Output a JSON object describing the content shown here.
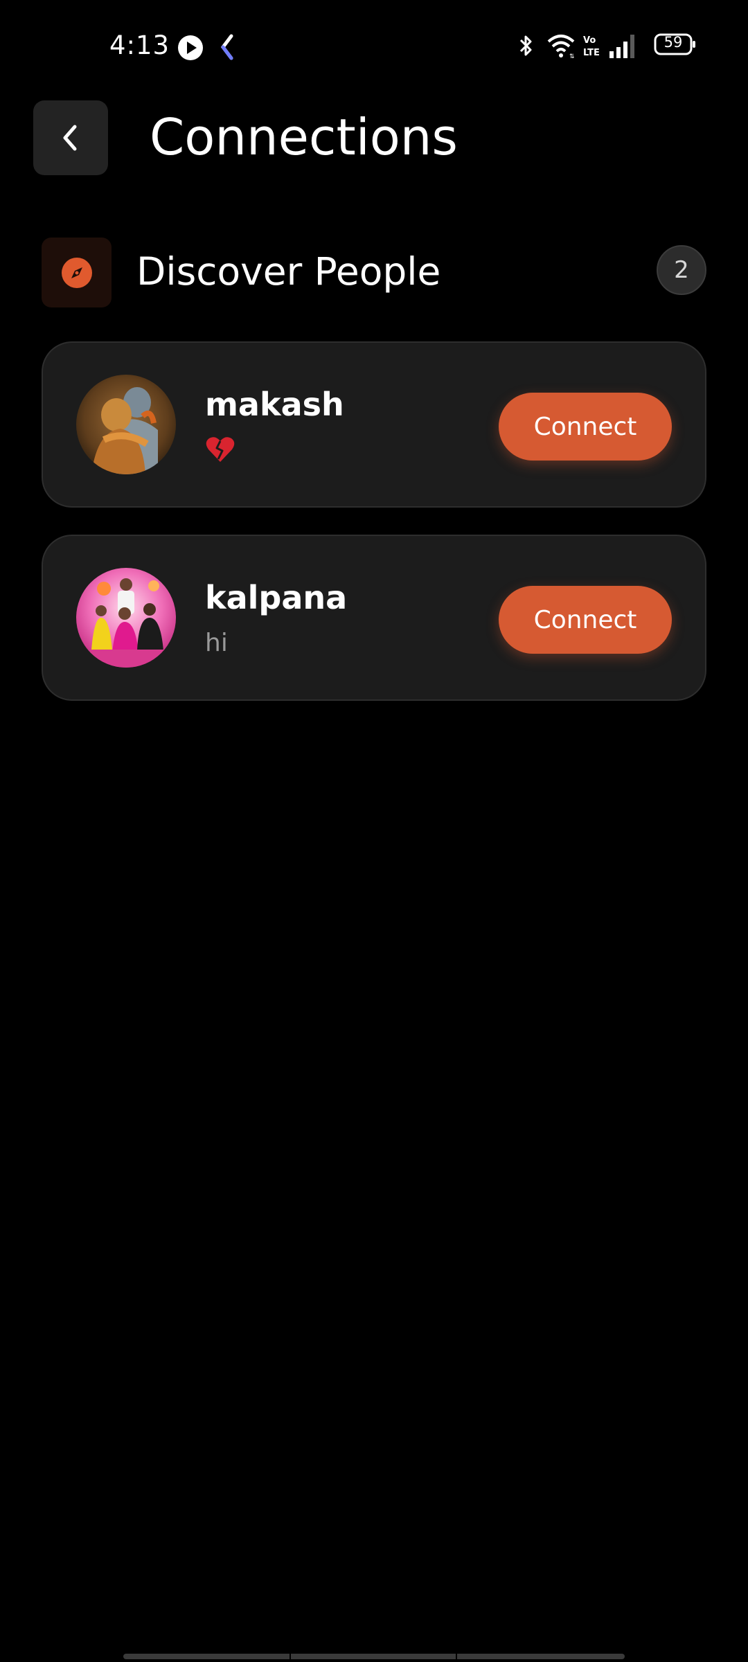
{
  "status_bar": {
    "time": "4:13",
    "battery_level": "59",
    "icons": [
      "play-icon",
      "app-k-icon",
      "bluetooth-icon",
      "wifi-icon",
      "volte-icon",
      "signal-icon",
      "battery-icon"
    ]
  },
  "header": {
    "title": "Connections",
    "back_icon": "chevron-left-icon"
  },
  "section": {
    "title": "Discover People",
    "icon": "compass-icon",
    "count": "2"
  },
  "people": [
    {
      "name": "makash",
      "status": "💔",
      "avatar": "avatar-image",
      "action_label": "Connect"
    },
    {
      "name": "kalpana",
      "status": "hi",
      "avatar": "avatar-image",
      "action_label": "Connect"
    }
  ],
  "colors": {
    "background": "#000000",
    "card": "#1c1c1c",
    "accent": "#d65a32",
    "muted_text": "#9a9a9a"
  }
}
